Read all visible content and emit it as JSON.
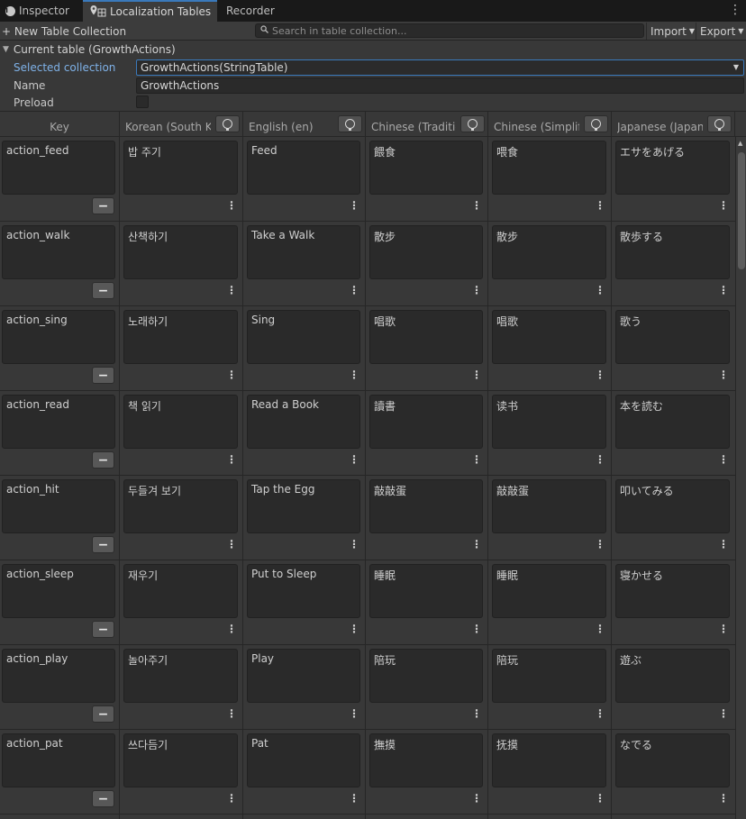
{
  "tabs": [
    {
      "label": "Inspector",
      "icon": "info-icon"
    },
    {
      "label": "Localization Tables",
      "icon": "localization-table-icon",
      "active": true
    },
    {
      "label": "Recorder"
    }
  ],
  "toolbar": {
    "new_collection_label": "+ New Table Collection",
    "search_placeholder": "Search in table collection...",
    "import_label": "Import",
    "export_label": "Export"
  },
  "current_table": {
    "foldout_label": "Current table (GrowthActions)",
    "selected_collection_label": "Selected collection",
    "selected_collection_value": "GrowthActions(StringTable)",
    "name_label": "Name",
    "name_value": "GrowthActions",
    "preload_label": "Preload",
    "preload_checked": false
  },
  "columns": [
    {
      "label": "Key"
    },
    {
      "label": "Korean (South Korea) (ko-KR)"
    },
    {
      "label": "English (en)"
    },
    {
      "label": "Chinese (Traditional) (zh-TW)"
    },
    {
      "label": "Chinese (Simplified) (zh-CN)"
    },
    {
      "label": "Japanese (Japan) (ja-JP)"
    }
  ],
  "rows": [
    {
      "key": "action_feed",
      "values": [
        "밥 주기",
        "Feed",
        "餵食",
        "喂食",
        "エサをあげる"
      ]
    },
    {
      "key": "action_walk",
      "values": [
        "산책하기",
        "Take a Walk",
        "散步",
        "散步",
        "散歩する"
      ]
    },
    {
      "key": "action_sing",
      "values": [
        "노래하기",
        "Sing",
        "唱歌",
        "唱歌",
        "歌う"
      ]
    },
    {
      "key": "action_read",
      "values": [
        "책 읽기",
        "Read a Book",
        "讀書",
        "读书",
        "本を読む"
      ]
    },
    {
      "key": "action_hit",
      "values": [
        "두들겨 보기",
        "Tap the Egg",
        "敲敲蛋",
        "敲敲蛋",
        "叩いてみる"
      ]
    },
    {
      "key": "action_sleep",
      "values": [
        "재우기",
        "Put to Sleep",
        "睡眠",
        "睡眠",
        "寝かせる"
      ]
    },
    {
      "key": "action_play",
      "values": [
        "놀아주기",
        "Play",
        "陪玩",
        "陪玩",
        "遊ぶ"
      ]
    },
    {
      "key": "action_pat",
      "values": [
        "쓰다듬기",
        "Pat",
        "撫摸",
        "抚摸",
        "なでる"
      ]
    }
  ],
  "colors": {
    "accent": "#3a79bb",
    "panel": "#383838",
    "field": "#2a2a2a"
  }
}
